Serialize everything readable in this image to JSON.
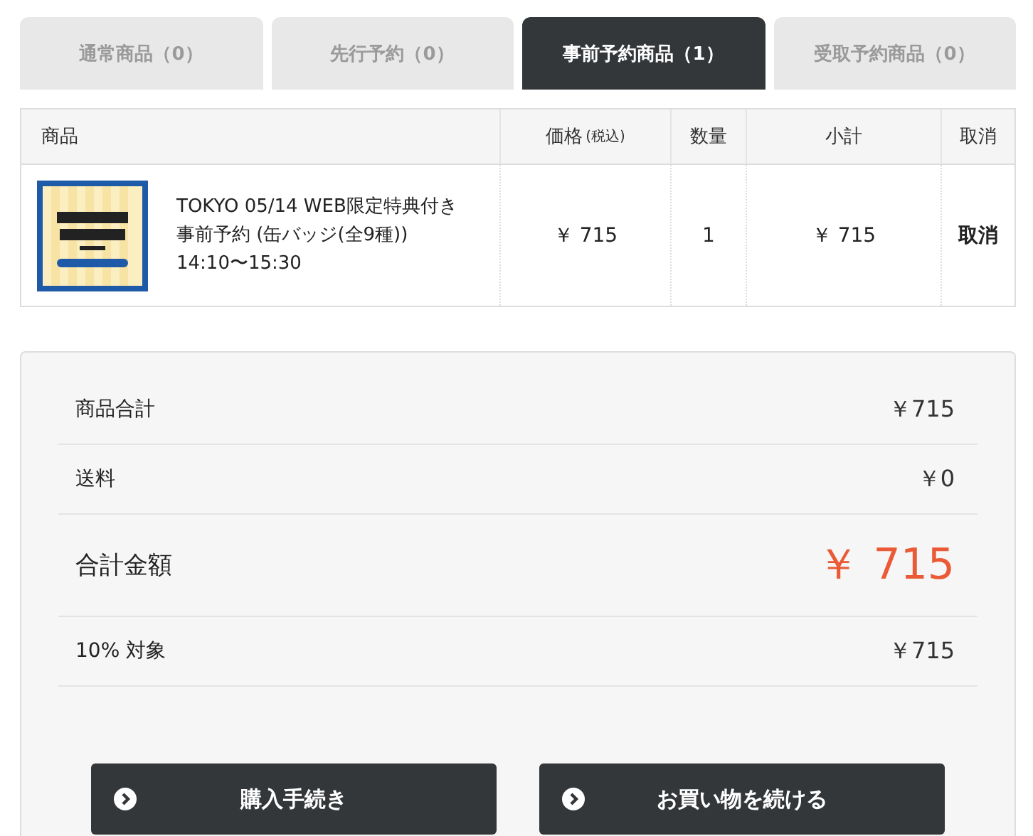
{
  "tabs": [
    {
      "label": "通常商品（0）",
      "selected": false
    },
    {
      "label": "先行予約（0）",
      "selected": false
    },
    {
      "label": "事前予約商品（1）",
      "selected": true
    },
    {
      "label": "受取予約商品（0）",
      "selected": false
    }
  ],
  "table": {
    "columns": [
      {
        "label": "商品"
      },
      {
        "label": "価格",
        "note": "(税込)"
      },
      {
        "label": "数量"
      },
      {
        "label": "小計"
      },
      {
        "label": "取消"
      }
    ],
    "rows": [
      {
        "name": "TOKYO 05/14 WEB限定特典付き事前予約 (缶バッジ(全9種)) 14:10〜15:30",
        "price": "￥ 715",
        "quantity": "1",
        "subtotal": "￥ 715",
        "cancel": "取消"
      }
    ]
  },
  "summary": [
    {
      "label": "商品合計",
      "value": "￥715",
      "kind": "normal"
    },
    {
      "label": "送料",
      "value": "￥0",
      "kind": "normal"
    },
    {
      "label": "合計金額",
      "value": "￥ 715",
      "kind": "total"
    },
    {
      "label": "10% 対象",
      "value": "￥715",
      "kind": "normal"
    }
  ],
  "buttons": [
    "購入手続き",
    "お買い物を続ける"
  ]
}
